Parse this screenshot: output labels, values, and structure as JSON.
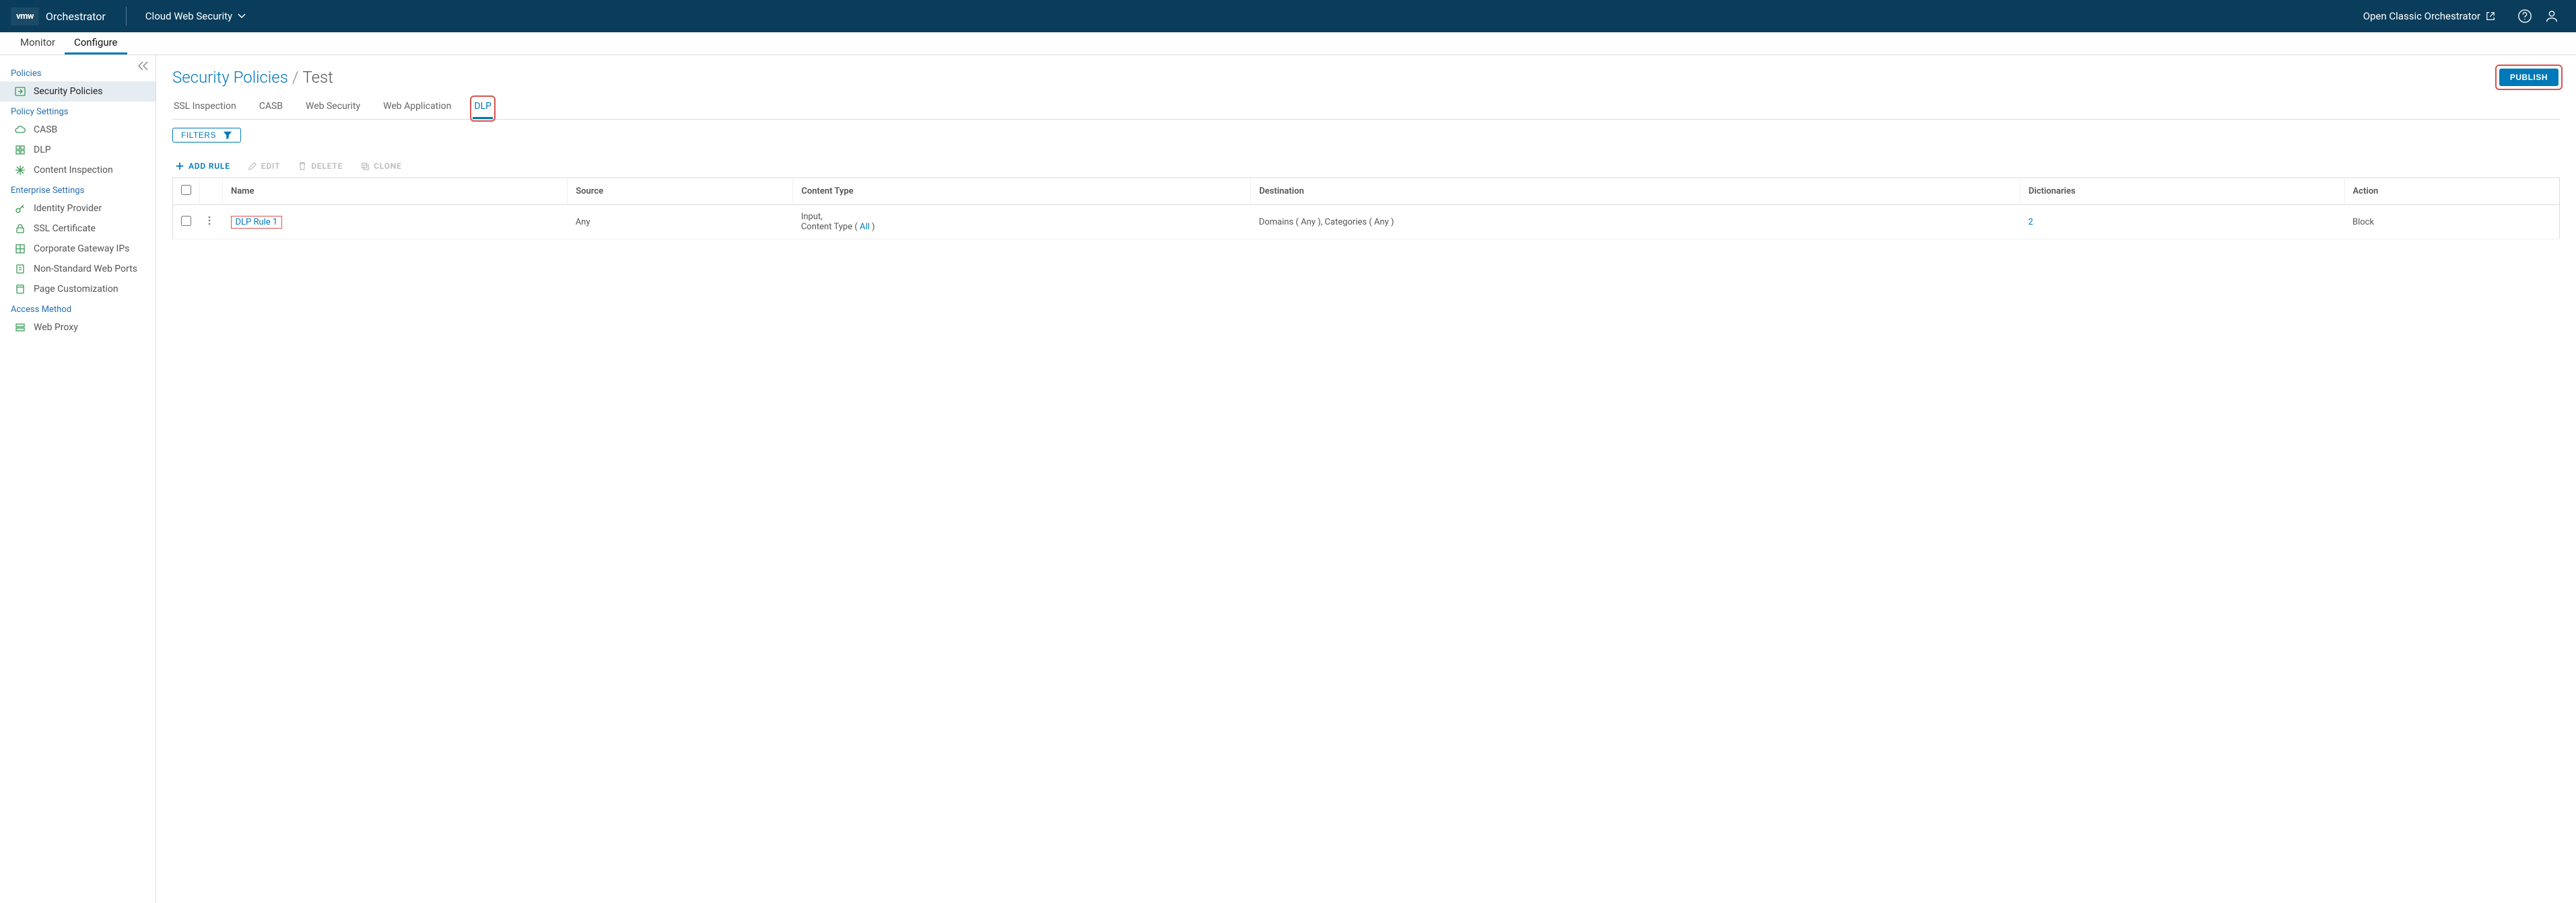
{
  "header": {
    "brand_short": "vmw",
    "brand_name": "Orchestrator",
    "context": "Cloud Web Security",
    "classic_link": "Open Classic Orchestrator"
  },
  "subnav": {
    "items": [
      "Monitor",
      "Configure"
    ],
    "active_index": 1
  },
  "sidebar": {
    "sections": [
      {
        "title": "Policies",
        "items": [
          {
            "label": "Security Policies",
            "icon": "login-icon",
            "active": true
          }
        ]
      },
      {
        "title": "Policy Settings",
        "items": [
          {
            "label": "CASB",
            "icon": "cloud-icon"
          },
          {
            "label": "DLP",
            "icon": "grid-icon"
          },
          {
            "label": "Content Inspection",
            "icon": "sparkle-icon"
          }
        ]
      },
      {
        "title": "Enterprise Settings",
        "items": [
          {
            "label": "Identity Provider",
            "icon": "key-icon"
          },
          {
            "label": "SSL Certificate",
            "icon": "lock-icon"
          },
          {
            "label": "Corporate Gateway IPs",
            "icon": "grid2-icon"
          },
          {
            "label": "Non-Standard Web Ports",
            "icon": "doc-icon"
          },
          {
            "label": "Page Customization",
            "icon": "page-icon"
          }
        ]
      },
      {
        "title": "Access Method",
        "items": [
          {
            "label": "Web Proxy",
            "icon": "proxy-icon"
          }
        ]
      }
    ]
  },
  "main": {
    "breadcrumb": {
      "root": "Security Policies",
      "current": "Test"
    },
    "publish_label": "PUBLISH",
    "policy_tabs": [
      "SSL Inspection",
      "CASB",
      "Web Security",
      "Web Application",
      "DLP"
    ],
    "policy_tab_active": 4,
    "filters_label": "FILTERS",
    "actions": {
      "add": "ADD RULE",
      "edit": "EDIT",
      "delete": "DELETE",
      "clone": "CLONE"
    },
    "table": {
      "columns": [
        "Name",
        "Source",
        "Content Type",
        "Destination",
        "Dictionaries",
        "Action"
      ],
      "rows": [
        {
          "name": "DLP Rule 1",
          "source": "Any",
          "content_type_line1": "Input,",
          "content_type_line2_prefix": "Content Type ( ",
          "content_type_link": "All",
          "content_type_line2_suffix": " )",
          "destination": "Domains ( Any ), Categories ( Any )",
          "dictionaries": "2",
          "action": "Block"
        }
      ]
    }
  }
}
